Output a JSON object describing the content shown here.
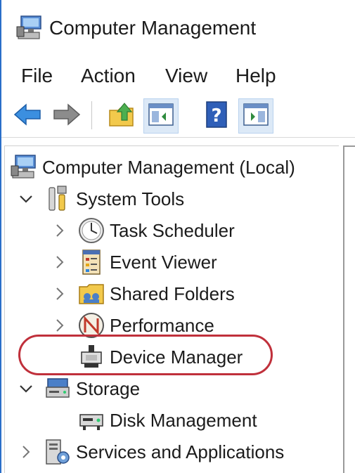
{
  "window": {
    "title": "Computer Management"
  },
  "menu": {
    "items": [
      {
        "label": "File"
      },
      {
        "label": "Action"
      },
      {
        "label": "View"
      },
      {
        "label": "Help"
      }
    ]
  },
  "toolbar": {
    "buttons": [
      {
        "icon": "back-arrow-icon"
      },
      {
        "icon": "forward-arrow-icon"
      },
      {
        "icon": "up-folder-icon"
      },
      {
        "icon": "show-hide-console-tree-icon"
      },
      {
        "icon": "help-icon",
        "glyph": "?"
      },
      {
        "icon": "show-hide-action-pane-icon"
      }
    ]
  },
  "tree": {
    "root": {
      "label": "Computer Management (Local)",
      "icon": "computer-management-icon"
    },
    "items": [
      {
        "label": "System Tools",
        "icon": "system-tools-icon",
        "expanded": true
      },
      {
        "label": "Task Scheduler",
        "icon": "clock-icon"
      },
      {
        "label": "Event Viewer",
        "icon": "event-viewer-icon"
      },
      {
        "label": "Shared Folders",
        "icon": "shared-folders-icon"
      },
      {
        "label": "Performance",
        "icon": "performance-icon"
      },
      {
        "label": "Device Manager",
        "icon": "device-manager-icon",
        "selected": true
      },
      {
        "label": "Storage",
        "icon": "storage-icon",
        "expanded": true
      },
      {
        "label": "Disk Management",
        "icon": "disk-management-icon"
      },
      {
        "label": "Services and Applications",
        "icon": "services-applications-icon"
      }
    ]
  },
  "colors": {
    "accent": "#2a6fc9",
    "annotation": "#c0303b",
    "selection": "#cce4f7"
  }
}
